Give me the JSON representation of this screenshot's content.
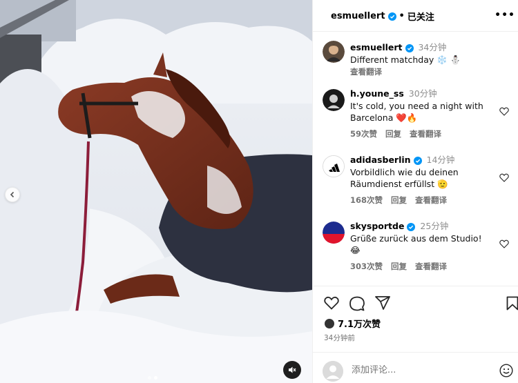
{
  "post": {
    "username": "esmuellert",
    "follow_label": "已关注",
    "separator": "•",
    "more_label": "•••"
  },
  "caption": {
    "username": "esmuellert",
    "time": "34分钟",
    "text": "Different matchday ❄️ ⛄",
    "translate": "查看翻译"
  },
  "comments": [
    {
      "username": "h.youne_ss",
      "time": "30分钟",
      "text": "It's cold, you need a night with Barcelona ❤️🔥",
      "likes": "59次赞",
      "reply": "回复",
      "translate": "查看翻译"
    },
    {
      "username": "adidasberlin",
      "time": "14分钟",
      "text": "Vorbildlich wie du deinen Räumdienst erfüllst 🫡",
      "likes": "168次赞",
      "reply": "回复",
      "translate": "查看翻译"
    },
    {
      "username": "skysportde",
      "time": "25分钟",
      "text": "Grüße zurück aus dem Studio! 😂",
      "likes": "303次赞",
      "reply": "回复",
      "translate": "查看翻译"
    }
  ],
  "likes_count": "7.1万次赞",
  "post_time": "34分钟前",
  "add_comment_placeholder": "添加评论...",
  "icons": {
    "verified": "verified-badge-icon",
    "heart": "heart-icon",
    "comment": "comment-icon",
    "share": "share-icon",
    "save": "bookmark-icon",
    "emoji": "emoji-icon",
    "mute": "speaker-muted-icon",
    "prev": "chevron-left-icon"
  },
  "colors": {
    "verified": "#0095f6",
    "secondary_text": "#737373",
    "border": "#efefef"
  },
  "carousel": {
    "current": 2,
    "total": 2
  }
}
